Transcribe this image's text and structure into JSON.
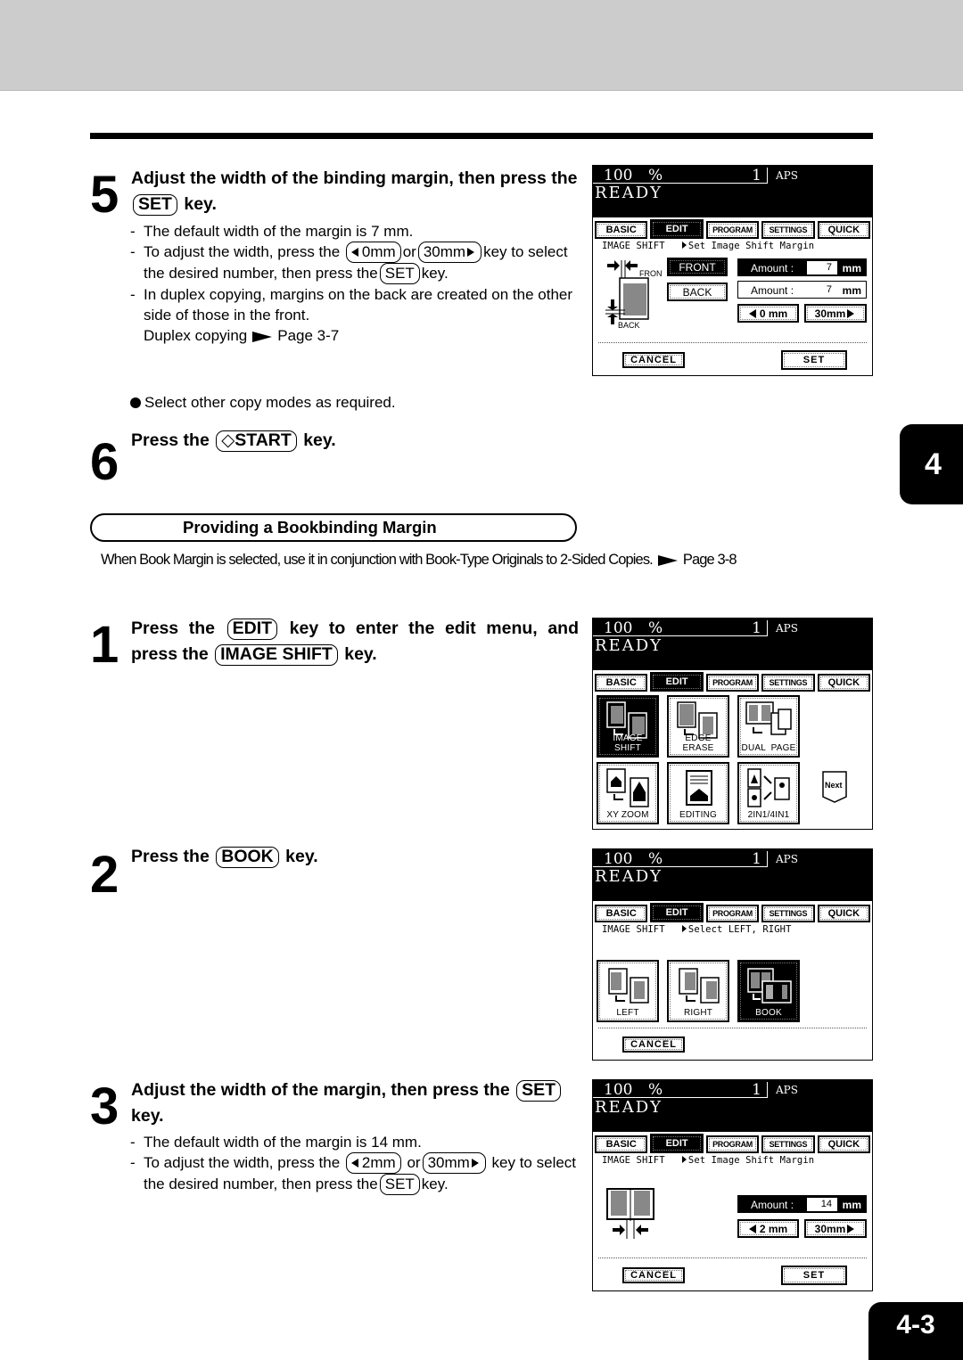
{
  "page": {
    "chapter_tab": "4",
    "page_number": "4-3"
  },
  "step5": {
    "number": "5",
    "title_pre": "Adjust the width of the binding margin, then press the",
    "title_key": "SET",
    "title_post": "key.",
    "bullets": {
      "b1": "The default width of the margin is 7 mm.",
      "b2_pre": "To adjust the width, press the",
      "b2_key1": "0mm",
      "b2_mid": "or",
      "b2_key2": "30mm",
      "b2_post": "key to select the desired number, then press the",
      "b2_key3": "SET",
      "b2_end": "key.",
      "b3": "In duplex copying, margins on the back are created on the other side of those in the front.",
      "b3_ref_pre": "Duplex copying",
      "b3_ref_post": "Page 3-7"
    }
  },
  "note": "Select other copy modes as required.",
  "step6": {
    "number": "6",
    "title_pre": "Press the",
    "title_key": "START",
    "title_post": "key."
  },
  "section": {
    "heading": "Providing a Bookbinding Margin",
    "desc_pre": "When Book Margin is selected, use it in conjunction with Book-Type Originals to 2-Sided Copies.",
    "desc_ref": "Page 3-8"
  },
  "step1": {
    "number": "1",
    "title_pre": "Press the",
    "title_key1": "EDIT",
    "title_mid": "key to enter the edit menu, and press the",
    "title_key2": "IMAGE SHIFT",
    "title_post": "key."
  },
  "step2": {
    "number": "2",
    "title_pre": "Press the",
    "title_key": "BOOK",
    "title_post": "key."
  },
  "step3": {
    "number": "3",
    "title_pre": "Adjust the width of the margin, then press the",
    "title_key": "SET",
    "title_post": "key.",
    "bullets": {
      "b1": "The default width of the margin is 14 mm.",
      "b2_pre": "To adjust the width, press the",
      "b2_key1": "2mm",
      "b2_mid": "or",
      "b2_key2": "30mm",
      "b2_post": "key to select the desired number, then press the",
      "b2_key3": "SET",
      "b2_end": "key."
    }
  },
  "lcd": {
    "zoom": "100",
    "pct": "%",
    "count": "1",
    "paper": "APS",
    "status": "READY",
    "tabs": [
      "BASIC",
      "EDIT",
      "PROGRAM",
      "SETTINGS",
      "QUICK"
    ],
    "active_tab": "EDIT"
  },
  "panel1": {
    "crumb_mode": "IMAGE SHIFT",
    "crumb_msg": "Set Image Shift Margin",
    "diagram_front": "FRONT",
    "diagram_back": "BACK",
    "front_btn": "FRONT",
    "back_btn": "BACK",
    "front_amount_label": "Amount :",
    "front_amount_value": "7",
    "back_amount_label": "Amount :",
    "back_amount_value": "7",
    "unit": "mm",
    "dec_btn": "0 mm",
    "inc_btn": "30mm",
    "cancel": "CANCEL",
    "set": "SET"
  },
  "panel2": {
    "icons": [
      "IMAGE SHIFT",
      "EDGE ERASE",
      "DUAL  PAGE",
      "XY ZOOM",
      "EDITING",
      "2IN1/4IN1"
    ],
    "next": "Next"
  },
  "panel3": {
    "crumb_mode": "IMAGE SHIFT",
    "crumb_msg": "Select LEFT, RIGHT",
    "options": [
      "LEFT",
      "RIGHT",
      "BOOK"
    ],
    "cancel": "CANCEL"
  },
  "panel4": {
    "crumb_mode": "IMAGE SHIFT",
    "crumb_msg": "Set Image Shift Margin",
    "amount_label": "Amount :",
    "amount_value": "14",
    "unit": "mm",
    "dec_btn": "2 mm",
    "inc_btn": "30mm",
    "cancel": "CANCEL",
    "set": "SET"
  }
}
